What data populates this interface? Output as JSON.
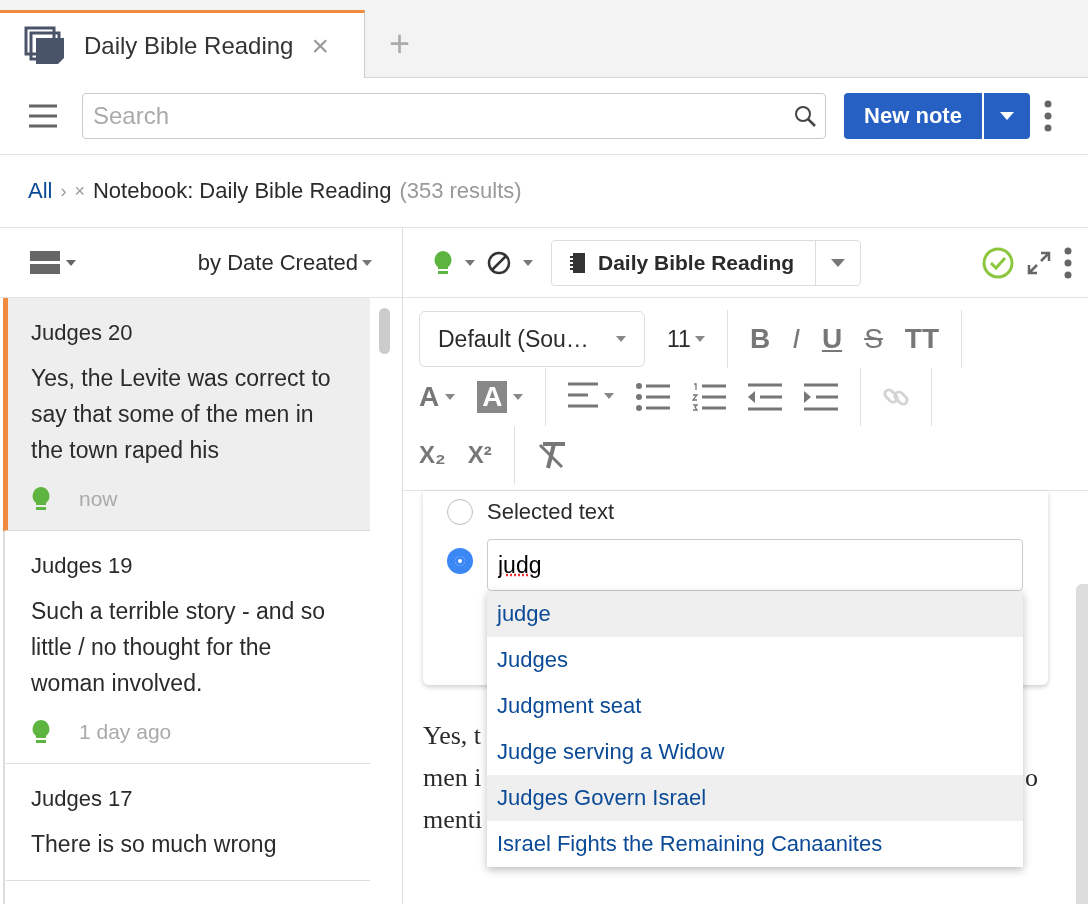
{
  "tab_bar": {
    "tabs": [
      {
        "title": "Daily Bible Reading",
        "close": "×",
        "selected": true
      }
    ],
    "new_tab": "+"
  },
  "toolbar": {
    "search": {
      "placeholder": "Search"
    },
    "new_note": "New note"
  },
  "breadcrumb": {
    "root": "All",
    "separator": "›",
    "remove": "×",
    "filter": "Notebook: Daily Bible Reading",
    "count": "(353 results)"
  },
  "note_list": {
    "sort": "by Date Created",
    "notes": [
      {
        "title": "Judges 20",
        "preview": "Yes, the Levite was correct to say that some of the men in the town raped his",
        "time": "now",
        "selected": true
      },
      {
        "title": "Judges 19",
        "preview": "Such a terrible story - and so little / no thought for the woman involved.",
        "time": "1 day ago",
        "selected": false
      },
      {
        "title": "Judges 17",
        "preview": "There is so much wrong",
        "selected": false
      }
    ]
  },
  "editor": {
    "notebook": "Daily Bible Reading",
    "format_toolbar": {
      "font": "Default (Sou…",
      "size": "11",
      "style_buttons": [
        {
          "label": "B",
          "kind": "bold"
        },
        {
          "label": "I",
          "kind": "italic"
        },
        {
          "label": "U",
          "kind": "underline"
        },
        {
          "label": "S",
          "kind": "strike"
        },
        {
          "label": "TT",
          "kind": "size"
        }
      ],
      "color_buttons": [
        {
          "label": "A",
          "kind": "text-color"
        },
        {
          "label": "A",
          "kind": "highlight"
        }
      ],
      "link_disabled": true,
      "script_buttons": [
        {
          "label": "X₂"
        },
        {
          "label": "X²"
        }
      ]
    },
    "link_dialog": {
      "options": [
        {
          "kind": "label",
          "label": "Selected text",
          "selected": false
        },
        {
          "kind": "input",
          "value": "judg",
          "selected": true
        }
      ],
      "suggestions": [
        {
          "label": "judge",
          "highlighted": true
        },
        {
          "label": "Judges",
          "highlighted": false
        },
        {
          "label": "Judgment seat",
          "highlighted": false
        },
        {
          "label": "Judge serving a Widow",
          "highlighted": false
        },
        {
          "label": "Judges Govern Israel",
          "highlighted": true
        },
        {
          "label": "Israel Fights the Remaining Canaanites",
          "highlighted": false
        }
      ]
    },
    "body_lines": [
      {
        "left": "Yes, t"
      },
      {
        "left": "men i",
        "right": "o"
      },
      {
        "left": "menti"
      }
    ]
  }
}
